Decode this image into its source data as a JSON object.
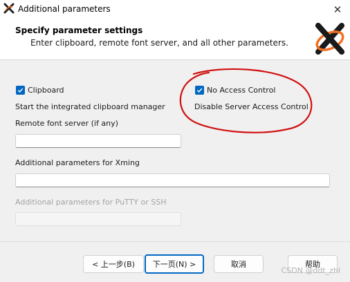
{
  "window": {
    "title": "Additional parameters",
    "close_glyph": "✕"
  },
  "header": {
    "title": "Specify parameter settings",
    "subtitle": "Enter clipboard, remote font server, and all other parameters."
  },
  "options": {
    "clipboard": {
      "label": "Clipboard",
      "checked": true,
      "description": "Start the integrated clipboard manager"
    },
    "no_access_control": {
      "label": "No Access Control",
      "checked": true,
      "description": "Disable Server Access Control"
    }
  },
  "fields": {
    "remote_font_server": {
      "label": "Remote font server (if any)",
      "value": ""
    },
    "xming_params": {
      "label": "Additional parameters for Xming",
      "value": ""
    },
    "putty_params": {
      "label": "Additional parameters for PuTTY or SSH",
      "value": "",
      "disabled": true
    }
  },
  "buttons": {
    "back": "< 上一步(B)",
    "next": "下一页(N) >",
    "cancel": "取消",
    "help": "帮助"
  },
  "watermark": "CSDN @ddt_zhl",
  "colors": {
    "accent": "#0067c0",
    "annotation": "#d01010",
    "logo_orange": "#f07020"
  }
}
